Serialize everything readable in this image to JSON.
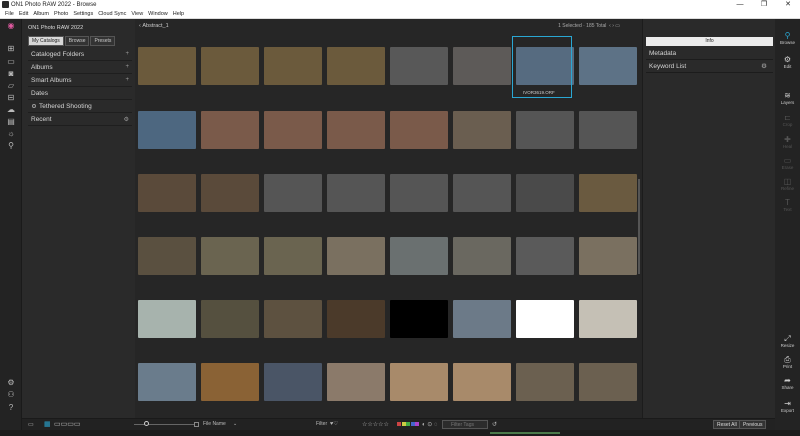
{
  "window": {
    "title": "ON1 Photo RAW 2022 - Browse",
    "min": "—",
    "max": "❐",
    "close": "✕"
  },
  "menu": [
    "File",
    "Edit",
    "Album",
    "Photo",
    "Settings",
    "Cloud Sync",
    "View",
    "Window",
    "Help"
  ],
  "browser": {
    "app_title": "ON1 Photo RAW 2022",
    "tabs": [
      "My Catalogs",
      "Browse",
      "Presets"
    ],
    "items": [
      {
        "label": "Cataloged Folders",
        "action": "+"
      },
      {
        "label": "Albums",
        "action": "+"
      },
      {
        "label": "Smart Albums",
        "action": "+"
      },
      {
        "label": "Dates",
        "action": ""
      },
      {
        "label": "Tethered Shooting",
        "action": ""
      },
      {
        "label": "Recent",
        "action": "⚙"
      }
    ]
  },
  "grid": {
    "path": "Abstract_1",
    "selection_info": "1 Selected · 185 Total",
    "selected_caption": "IVOR3619.ORF",
    "rows": [
      [
        "#6b5a3c",
        "#6b5a3c",
        "#6b5a3c",
        "#6b5a3c",
        "#585858",
        "#5d5a58",
        "#566b80",
        "#5d7286"
      ],
      [
        "#4d6780",
        "#7a5a4a",
        "#7a5a4a",
        "#7a5a4a",
        "#7a5a4a",
        "#6a5e50",
        "#555",
        "#555"
      ],
      [
        "#5a4a3a",
        "#5a4a3a",
        "#555",
        "#555",
        "#555",
        "#555",
        "#4a4a4a",
        "#6a5a40"
      ],
      [
        "#5a5040",
        "#6a6450",
        "#6a6450",
        "#7a7060",
        "#6a7070",
        "#6a6860",
        "#5a5a5a",
        "#7a7060"
      ],
      [
        "#a7b3ad",
        "#55503f",
        "#5d5140",
        "#4b3a2a",
        "#000000",
        "#6c7a88",
        "#ffffff",
        "#c5c0b5"
      ],
      [
        "#6a7c8c",
        "#8a6235",
        "#4a5566",
        "#8b7a6a",
        "#a88a6a",
        "#a88a6a",
        "#6b6050",
        "#6b6050"
      ]
    ]
  },
  "inspector": {
    "info_label": "Info",
    "metadata": "Metadata",
    "keyword_list": "Keyword List"
  },
  "right_toolbar": [
    "Browse",
    "Edit",
    "Layers",
    "Crop",
    "Heal",
    "Erase",
    "Refine",
    "Text",
    "Resize",
    "Print",
    "Share",
    "Export"
  ],
  "bottom": {
    "sort": "File Name",
    "filter": "Filter",
    "search_placeholder": "Filter Tags",
    "reset_all": "Reset All",
    "previous": "Previous"
  },
  "colors": {
    "accent": "#2aa7d3"
  }
}
